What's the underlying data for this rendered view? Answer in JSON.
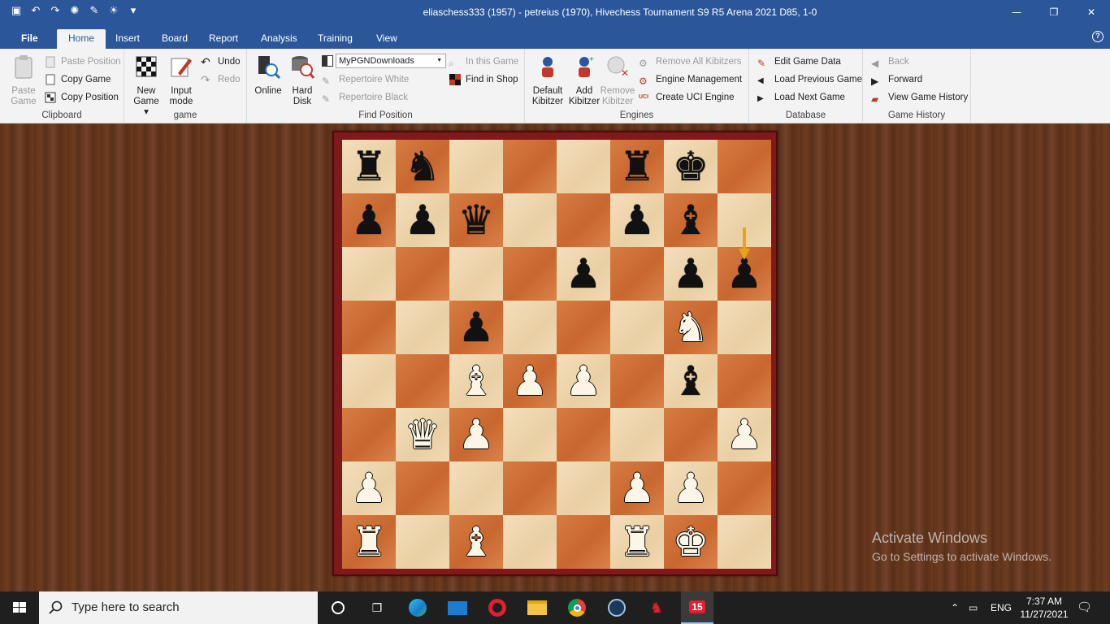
{
  "window": {
    "title": "eliaschess333 (1957) - petreius (1970), Hivechess Tournament S9 R5 Arena 2021  D85, 1-0",
    "controls": [
      "—",
      "❐",
      "✕"
    ]
  },
  "menu": {
    "file": "File",
    "tabs": [
      "Home",
      "Insert",
      "Board",
      "Report",
      "Analysis",
      "Training",
      "View"
    ],
    "active": "Home"
  },
  "ribbon": {
    "clipboard": {
      "label": "Clipboard",
      "paste_game": [
        "Paste",
        "Game"
      ],
      "paste_position": "Paste Position",
      "copy_game": "Copy Game",
      "copy_position": "Copy Position"
    },
    "game": {
      "label": "game",
      "new_game": [
        "New",
        "Game ▾"
      ],
      "input_mode": [
        "Input",
        "mode"
      ],
      "undo": "Undo",
      "redo": "Redo"
    },
    "find_position": {
      "label": "Find Position",
      "online": "Online",
      "hard_disk": [
        "Hard",
        "Disk"
      ],
      "database_select": "MyPGNDownloads",
      "in_this_game": "In this Game",
      "find_in_shop": "Find in Shop",
      "repertoire_white": "Repertoire White",
      "repertoire_black": "Repertoire Black"
    },
    "engines": {
      "label": "Engines",
      "default_kibitzer": [
        "Default",
        "Kibitzer"
      ],
      "add_kibitzer": [
        "Add",
        "Kibitzer"
      ],
      "remove_kibitzer": [
        "Remove",
        "Kibitzer"
      ],
      "remove_all_kibitzers": "Remove All Kibitzers",
      "engine_management": "Engine Management",
      "create_uci_engine": "Create UCI Engine"
    },
    "database": {
      "label": "Database",
      "edit_game_data": "Edit Game Data",
      "load_previous_game": "Load Previous Game",
      "load_next_game": "Load Next Game"
    },
    "game_history": {
      "label": "Game History",
      "back": "Back",
      "forward": "Forward",
      "view_game_history": "View Game History"
    }
  },
  "board": {
    "ranks": [
      [
        "r",
        "n",
        "",
        "",
        "",
        "r",
        "k",
        ""
      ],
      [
        "p",
        "p",
        "q",
        "",
        "",
        "p",
        "b",
        ""
      ],
      [
        "",
        "",
        "",
        "",
        "p",
        "",
        "p",
        "p"
      ],
      [
        "",
        "",
        "p",
        "",
        "",
        "",
        "N",
        ""
      ],
      [
        "",
        "",
        "B",
        "P",
        "P",
        "",
        "b",
        ""
      ],
      [
        "",
        "Q",
        "P",
        "",
        "",
        "",
        "",
        "P"
      ],
      [
        "P",
        "",
        "",
        "",
        "",
        "P",
        "P",
        ""
      ],
      [
        "R",
        "",
        "B",
        "",
        "",
        "R",
        "K",
        ""
      ]
    ],
    "last_move_to": "h6",
    "colors": {
      "light": "#f1d9b3",
      "dark": "#d07238",
      "frame": "#801919",
      "arrow": "#e8a317"
    }
  },
  "watermark": {
    "line1": "Activate Windows",
    "line2": "Go to Settings to activate Windows."
  },
  "taskbar": {
    "search_placeholder": "Type here to search",
    "badge": "15",
    "language": "ENG",
    "time": "7:37 AM",
    "date": "11/27/2021"
  }
}
